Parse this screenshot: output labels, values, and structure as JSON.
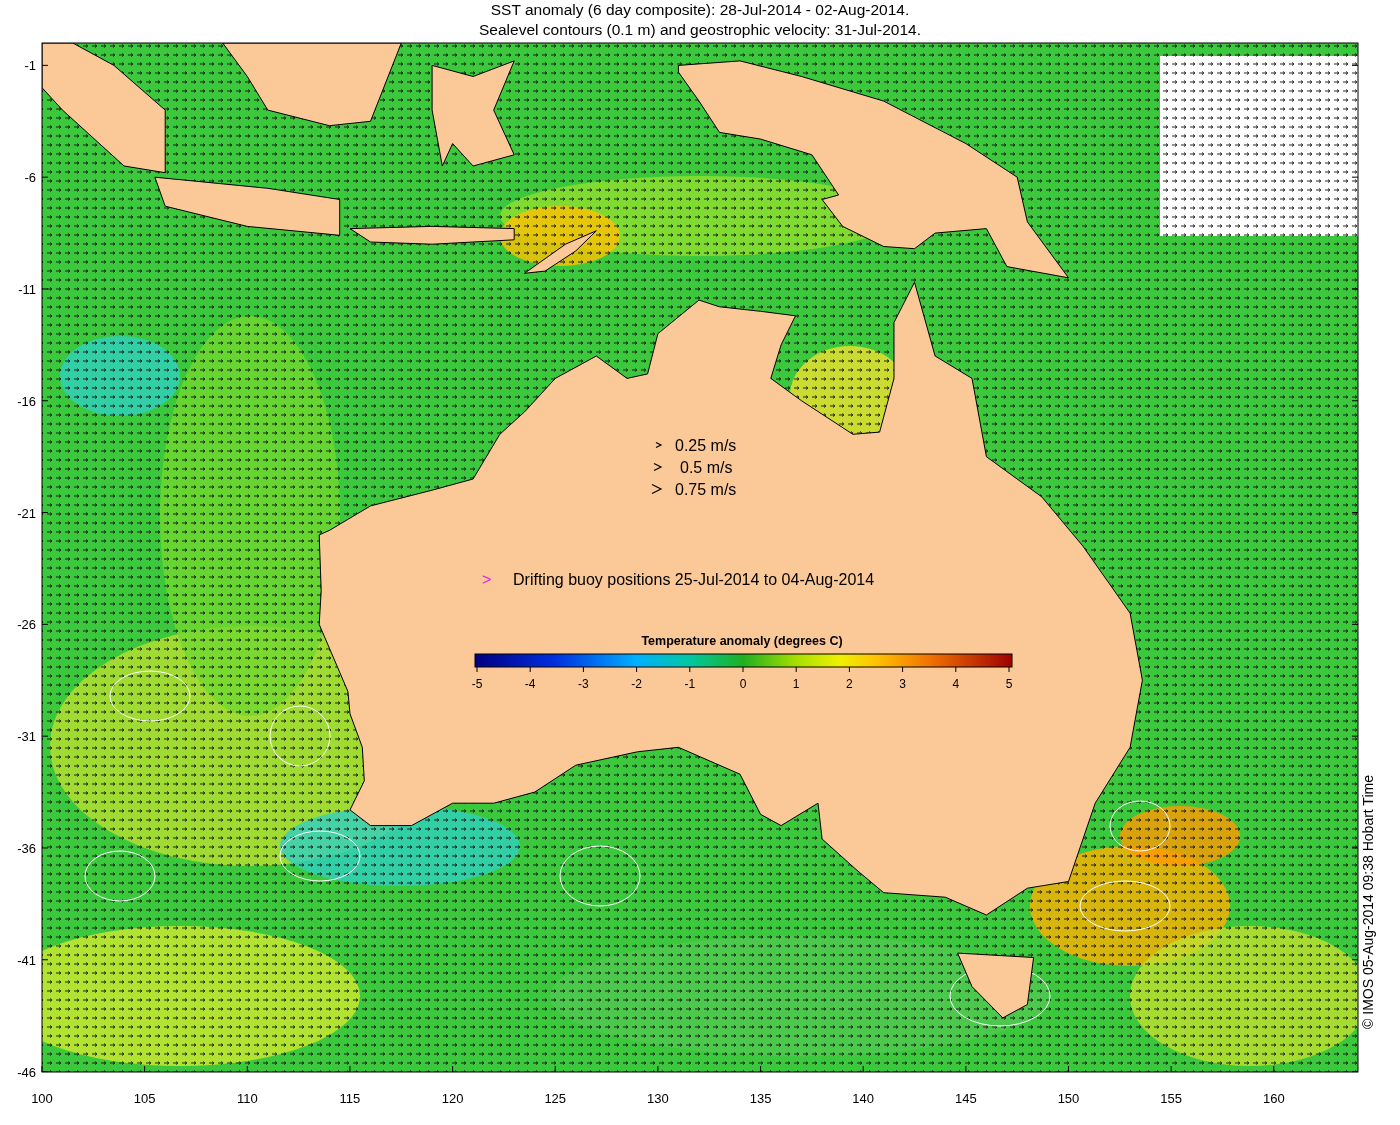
{
  "title_lines": [
    "SST anomaly (6 day composite): 28-Jul-2014 - 02-Aug-2014.",
    "Sealevel contours (0.1 m) and geostrophic velocity: 31-Jul-2014."
  ],
  "map": {
    "y_ticks": [
      "-1",
      "-6",
      "-11",
      "-16",
      "-21",
      "-26",
      "-31",
      "-36",
      "-41",
      "-46"
    ],
    "x_ticks": [
      "100",
      "105",
      "110",
      "115",
      "120",
      "125",
      "130",
      "135",
      "140",
      "145",
      "150",
      "155",
      "160"
    ]
  },
  "velocity_legend": [
    {
      "label": "0.25 m/s"
    },
    {
      "label": "0.5 m/s"
    },
    {
      "label": "0.75 m/s"
    }
  ],
  "buoy_legend": {
    "marker": ">",
    "label": "Drifting buoy positions 25-Jul-2014 to 04-Aug-2014"
  },
  "colorbar": {
    "title": "Temperature anomaly (degrees C)",
    "ticks": [
      "-5",
      "-4",
      "-3",
      "-2",
      "-1",
      "0",
      "1",
      "2",
      "3",
      "4",
      "5"
    ]
  },
  "credit": "© IMOS 05-Aug-2014 09:38 Hobart Time"
}
